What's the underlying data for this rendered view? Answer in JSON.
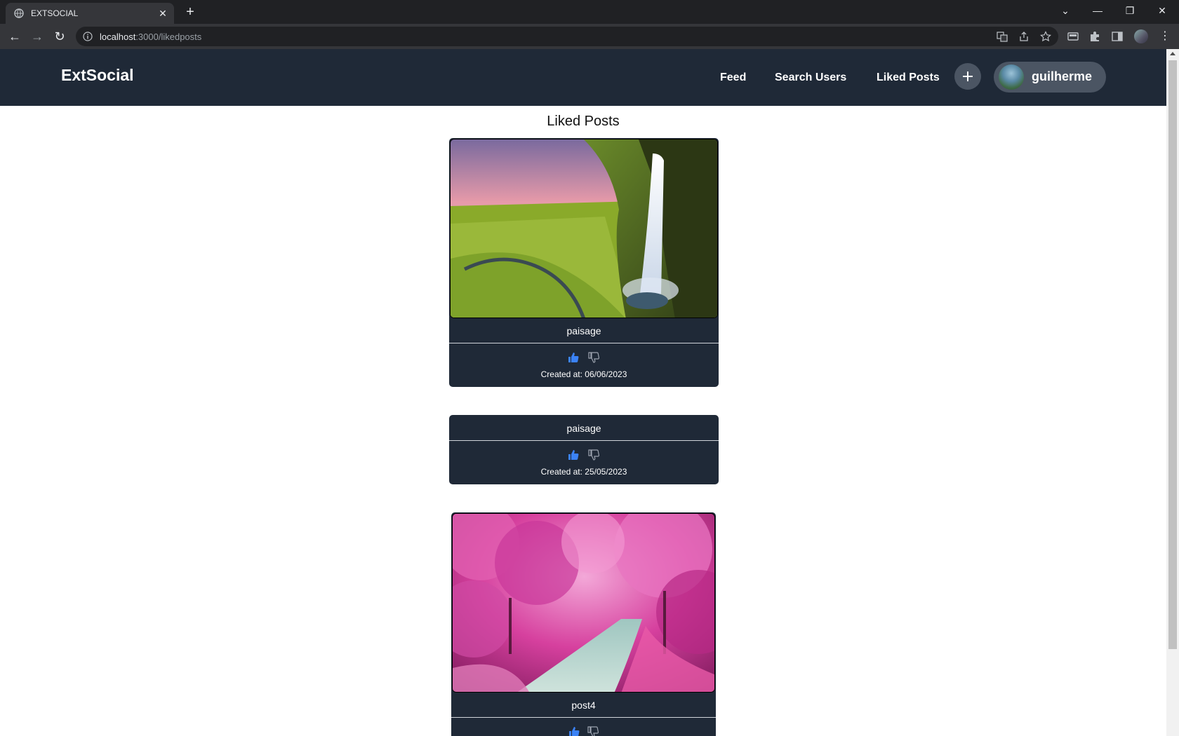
{
  "browser": {
    "tab_title": "EXTSOCIAL",
    "url_host": "localhost",
    "url_path": ":3000/likedposts"
  },
  "app": {
    "brand": "ExtSocial",
    "nav": {
      "feed": "Feed",
      "search_users": "Search Users",
      "liked_posts": "Liked Posts"
    },
    "user": {
      "name": "guilherme"
    }
  },
  "page": {
    "heading": "Liked Posts",
    "posts": [
      {
        "title": "paisage",
        "created": "Created at: 06/06/2023",
        "image": "waterfall-landscape",
        "liked": true
      },
      {
        "title": "paisage",
        "created": "Created at: 25/05/2023",
        "image": "",
        "liked": true
      },
      {
        "title": "post4",
        "created": "",
        "image": "pink-forest-path",
        "liked": true
      }
    ]
  },
  "colors": {
    "nav_bg": "#1f2937",
    "chip_bg": "#4b5563",
    "like_blue": "#3b82f6"
  }
}
